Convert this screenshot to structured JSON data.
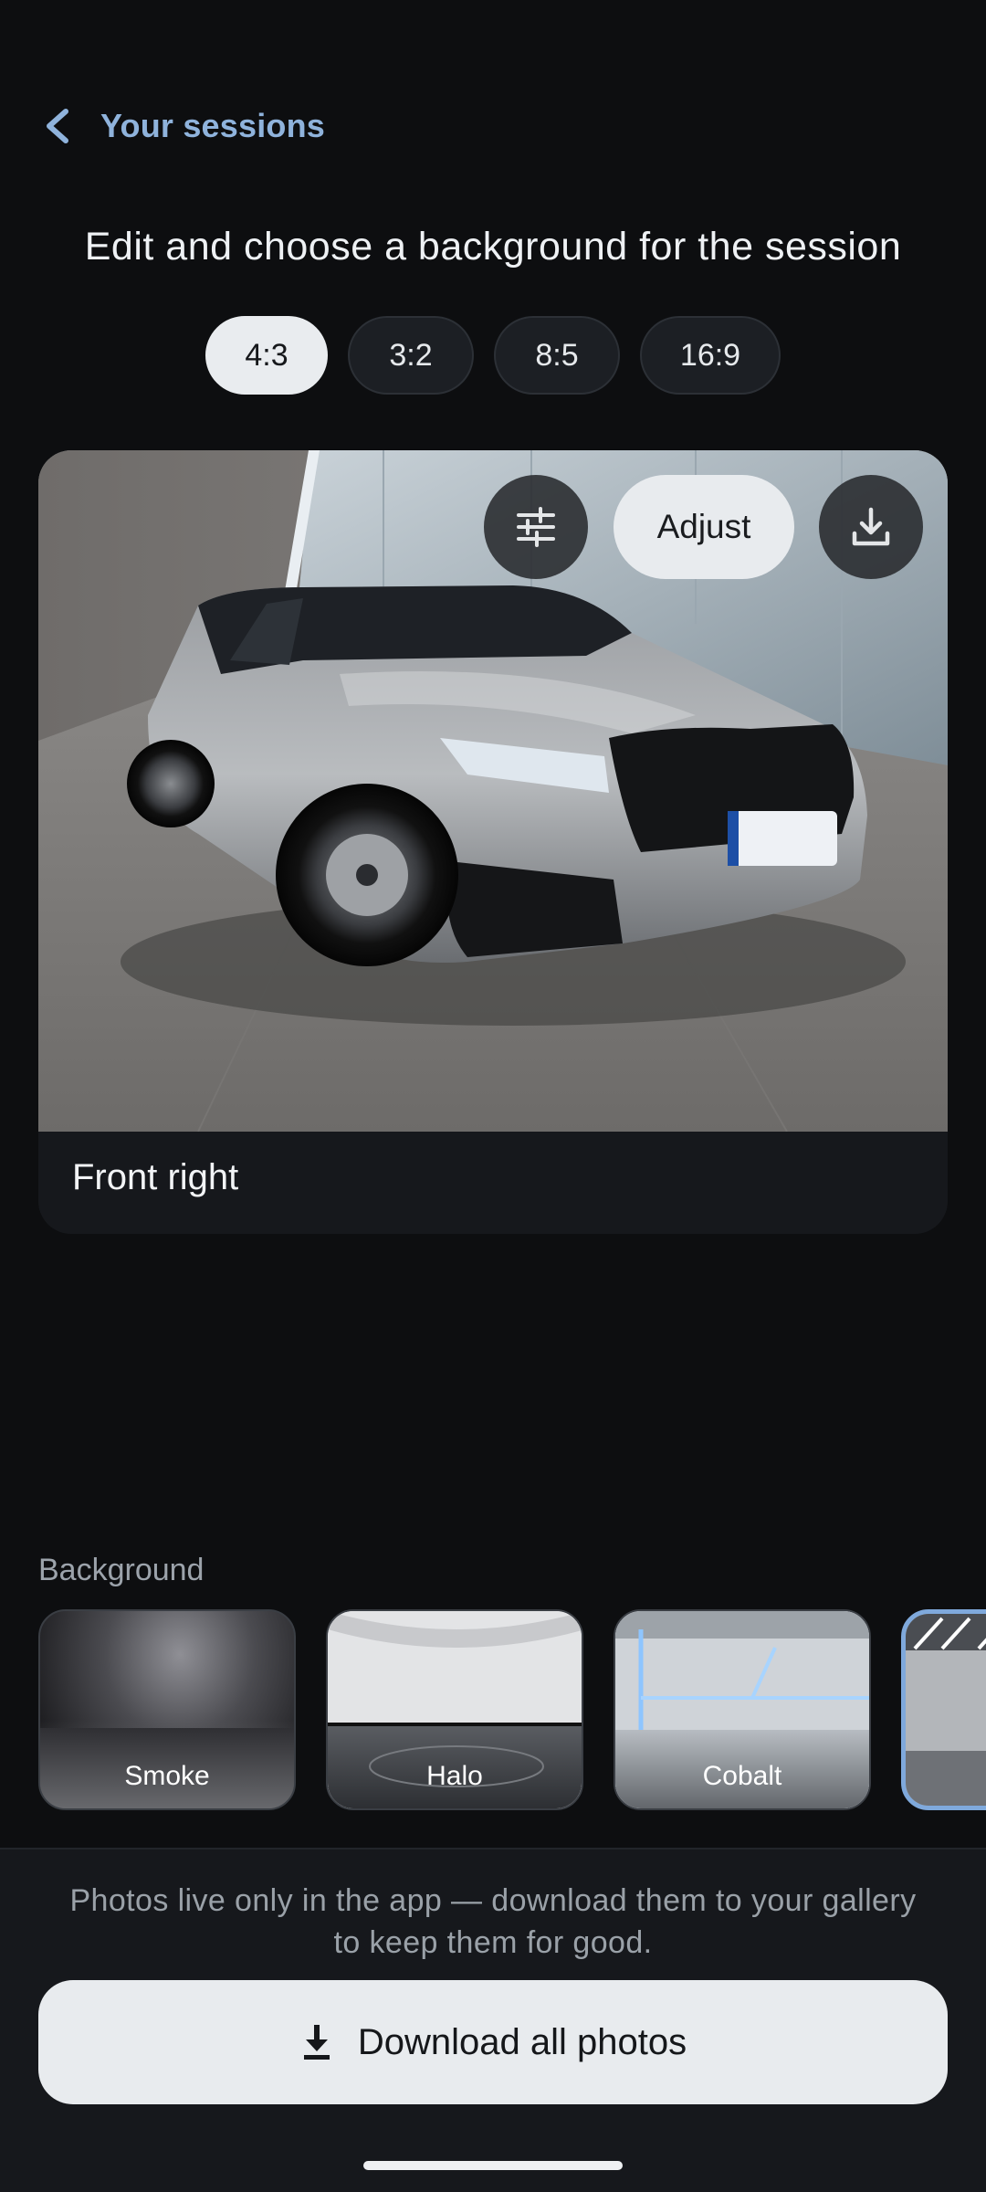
{
  "nav": {
    "back_label": "Your sessions",
    "back_icon": "chevron-left-icon"
  },
  "title": "Edit and choose a background for the session",
  "ratios": {
    "options": [
      "4:3",
      "3:2",
      "8:5",
      "16:9"
    ],
    "selected": "4:3"
  },
  "photo_card": {
    "caption": "Front right",
    "adjust_label": "Adjust",
    "icons": [
      "sliders-icon",
      "download-icon"
    ]
  },
  "backgrounds": {
    "label": "Background",
    "items": [
      {
        "name": "Smoke",
        "selected": false
      },
      {
        "name": "Halo",
        "selected": false
      },
      {
        "name": "Cobalt",
        "selected": false
      },
      {
        "name": "",
        "selected": true
      }
    ]
  },
  "bottom": {
    "notice": "Photos live only in the app — download them to your gallery to keep them for good.",
    "download_all_label": "Download all photos"
  },
  "colors": {
    "accent": "#8fb3dc",
    "background": "#0d0e10",
    "button": "#e8ebee"
  }
}
